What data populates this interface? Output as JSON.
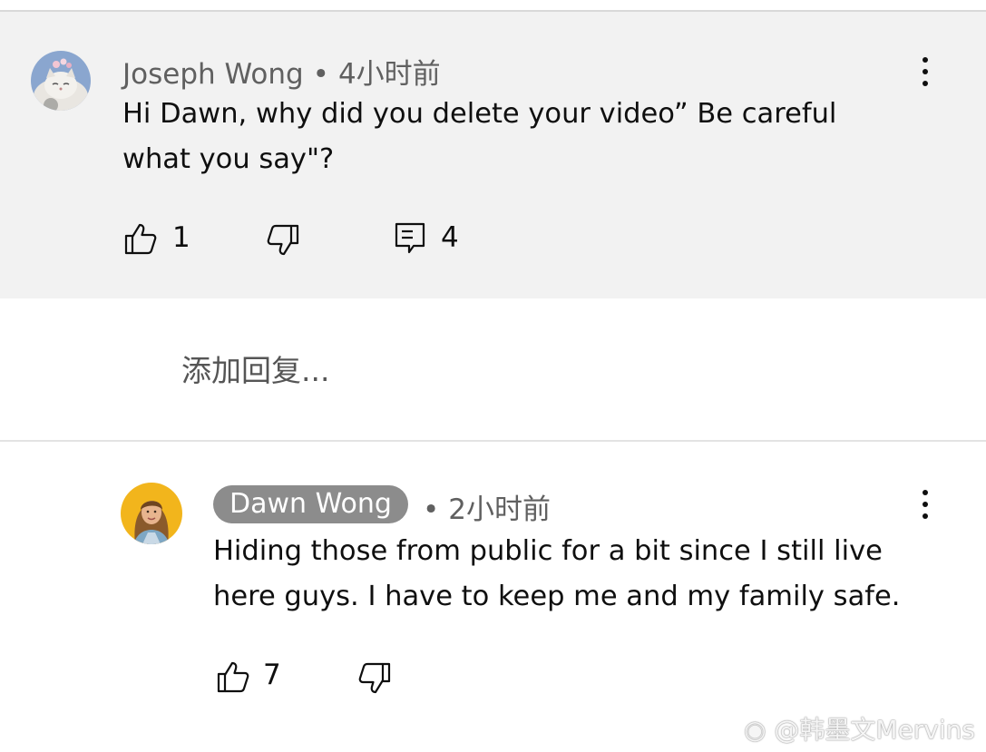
{
  "comment": {
    "author": "Joseph Wong",
    "separator": "•",
    "time": "4小时前",
    "text_line1": "Hi Dawn,  why did you delete your video” Be careful",
    "text_line2": "what you say\"?",
    "likes": "1",
    "replies": "4"
  },
  "reply_input": {
    "placeholder": "添加回复..."
  },
  "reply": {
    "author": "Dawn Wong",
    "separator": "•",
    "time": "2小时前",
    "text_line1": "Hiding those from public for a bit since I still live",
    "text_line2": "here guys.  I have to keep me and my family safe.",
    "likes": "7"
  },
  "watermark": "@韩墨文Mervins",
  "colors": {
    "comment_background": "#f2f2f2",
    "creator_chip": "#8c8c8c",
    "secondary_text": "#606060"
  }
}
